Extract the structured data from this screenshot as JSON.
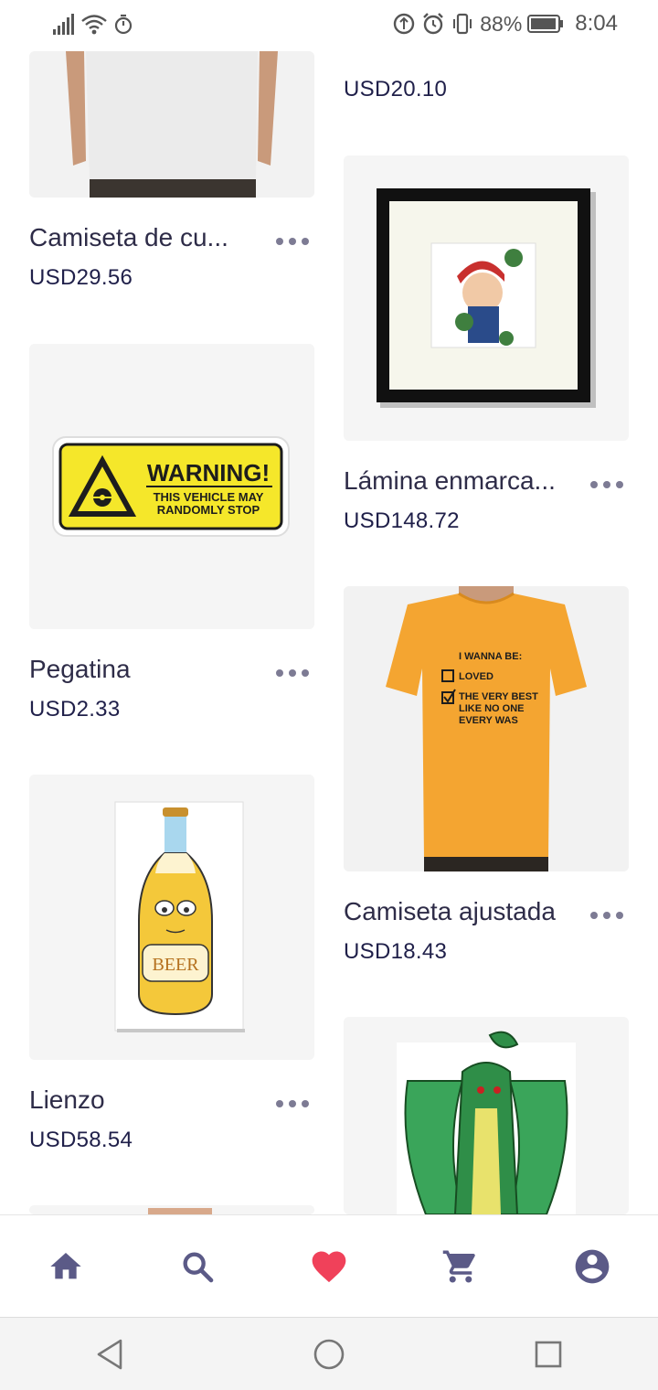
{
  "status_bar": {
    "battery": "88%",
    "time": "8:04"
  },
  "colors": {
    "accent": "#5b5a87",
    "heart": "#f0415a",
    "price": "#20204a"
  },
  "products": [
    {
      "title": "Camiseta de cu...",
      "price": "USD29.56"
    },
    {
      "title": "",
      "price": "USD20.10"
    },
    {
      "title": "Lámina enmarca...",
      "price": "USD148.72"
    },
    {
      "title": "Pegatina",
      "price": "USD2.33"
    },
    {
      "title": "Camiseta ajustada",
      "price": "USD18.43"
    },
    {
      "title": "Lienzo",
      "price": "USD58.54"
    }
  ],
  "sticker": {
    "headline": "WARNING!",
    "line1": "THIS VEHICLE MAY",
    "line2": "RANDOMLY STOP"
  },
  "tshirt_print": {
    "heading": "I WANNA BE:",
    "option1": "LOVED",
    "option2_l1": "THE VERY BEST",
    "option2_l2": "LIKE NO ONE",
    "option2_l3": "EVERY WAS"
  },
  "beer_label": "BEER",
  "bottom_nav": {
    "items": [
      {
        "icon": "home-icon"
      },
      {
        "icon": "search-icon"
      },
      {
        "icon": "heart-icon"
      },
      {
        "icon": "cart-icon"
      },
      {
        "icon": "account-icon"
      }
    ]
  },
  "system_nav": {
    "items": [
      "back-icon",
      "home-circle-icon",
      "recents-icon"
    ]
  }
}
